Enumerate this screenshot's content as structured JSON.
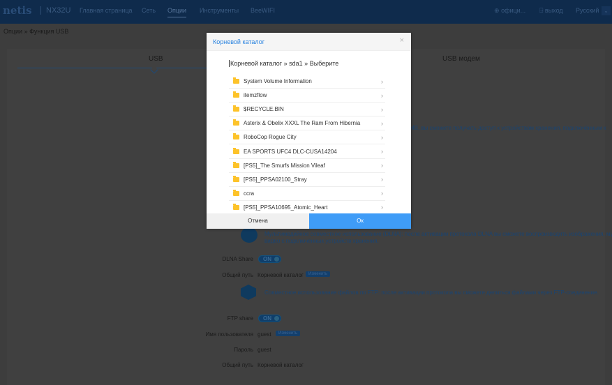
{
  "header": {
    "logo": "netis",
    "model": "NX32U",
    "nav": [
      "Главная страница",
      "Сеть",
      "Опции",
      "Инструменты",
      "BeeWIFI"
    ],
    "active_nav": 2,
    "site": "офици...",
    "logout": "выход",
    "language": "Русский"
  },
  "breadcrumb": "Опции » Функция USB",
  "tabs": [
    "USB",
    "USB модем"
  ],
  "bg": {
    "smb_desc_fragment": "МВ, вы сможете получать доступ к устройствам хранения, подключённым к",
    "dlna_desc": [
      "Мультимедийное совместное использование (DLNA): после активации протокола DLNA вы сможете воспроизводить изображения, музыку и",
      "видео с подключённых устройств хранения."
    ],
    "dlna_share_label": "DLNA Share",
    "dlna_toggle": "ON",
    "dlna_path_label": "Общий путь",
    "dlna_path": "Корневой каталог",
    "change": "Изменить",
    "ftp_desc": "Совместное использование файлов по FTP: после активации протокола вы сможете делиться файлами через FTP-соединение.",
    "ftp_share_label": "FTP share",
    "ftp_toggle": "ON",
    "user_label": "Имя пользователя",
    "user": "guest",
    "pass_label": "Пароль",
    "pass": "guest",
    "ftp_path_label": "Общий путь",
    "ftp_path": "Корневой каталог"
  },
  "modal": {
    "title": "Корневой каталог",
    "crumb": {
      "root": "Корневой каталог",
      "sep": "»",
      "dir": "sda1",
      "select": "Выберите"
    },
    "items": [
      "System Volume Information",
      "itemzflow",
      "$RECYCLE.BIN",
      "Asterix & Obelix XXXL The Ram From Hibernia",
      "RoboCop Rogue City",
      "EA SPORTS UFC4 DLC-CUSA14204",
      "[PS5]_The Smurfs Mission Vileaf",
      "[PS5]_PPSA02100_Stray",
      "ccra",
      "[PS5]_PPSA10695_Atomic_Heart"
    ],
    "cancel": "Отмена",
    "ok": "Ок"
  }
}
